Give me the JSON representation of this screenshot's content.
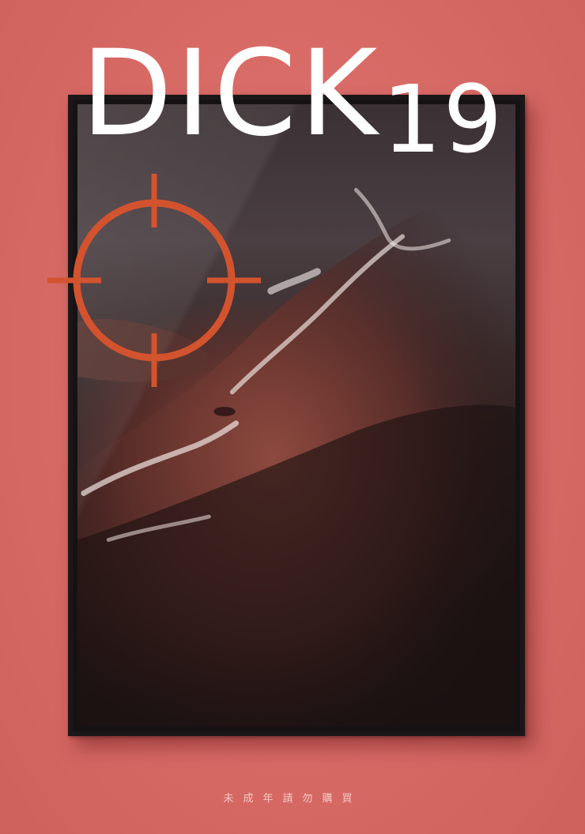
{
  "poster": {
    "title_main": "DICK",
    "title_number": "19",
    "warning_text": "未成年請勿購買"
  },
  "colors": {
    "background": "#d96a66",
    "frame": "#161213",
    "title": "#ffffff",
    "reticle": "#d2532e",
    "warning_text": "#f3c9c4"
  },
  "icons": {
    "reticle": "crosshair-target-icon"
  }
}
